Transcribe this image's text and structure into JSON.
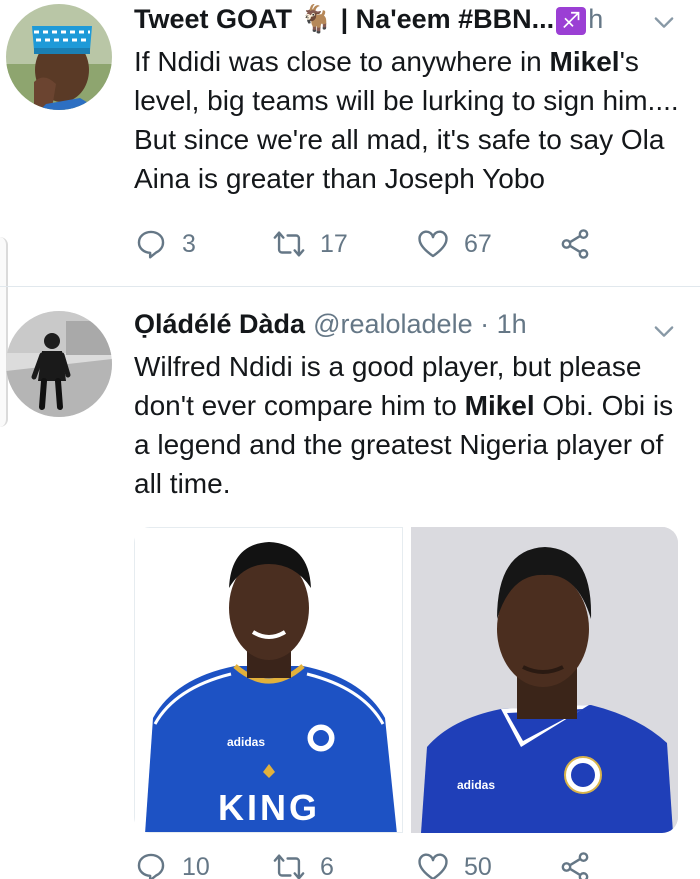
{
  "tweet1": {
    "display_name": "Tweet GOAT 🐐 | Na'eem #BBN...",
    "time_partial": "h",
    "text_before": "If Ndidi was close to anywhere in ",
    "text_bold": "Mikel",
    "text_after": "'s level, big teams will be lurking to sign him.... But since we're all mad, it's safe to say Ola Aina is greater than Joseph Yobo",
    "replies": "3",
    "retweets": "17",
    "likes": "67"
  },
  "tweet2": {
    "display_name": "Ọládélé Dàda",
    "handle": "@realoladele",
    "separator": " · ",
    "time": "1h",
    "text_before": "Wilfred Ndidi is a good player, but please don't ever compare him to ",
    "text_bold": "Mikel",
    "text_after": " Obi. Obi is a legend and the greatest Nigeria player of all time.",
    "left_photo_brand": "adidas",
    "left_photo_sponsor": "KING",
    "right_photo_brand": "adidas",
    "replies": "10",
    "retweets": "6",
    "likes": "50"
  },
  "icons": {
    "reply": "reply-icon",
    "retweet": "retweet-icon",
    "like": "heart-icon",
    "share": "share-icon",
    "caret": "chevron-down-icon",
    "zodiac": "sagittarius-icon"
  },
  "colors": {
    "text": "#14171a",
    "muted": "#657786",
    "divider": "#e1e8ed",
    "leicester_blue": "#1d52c4",
    "chelsea_blue": "#1f3fb8",
    "zodiac_purple": "#9b3fd4"
  }
}
